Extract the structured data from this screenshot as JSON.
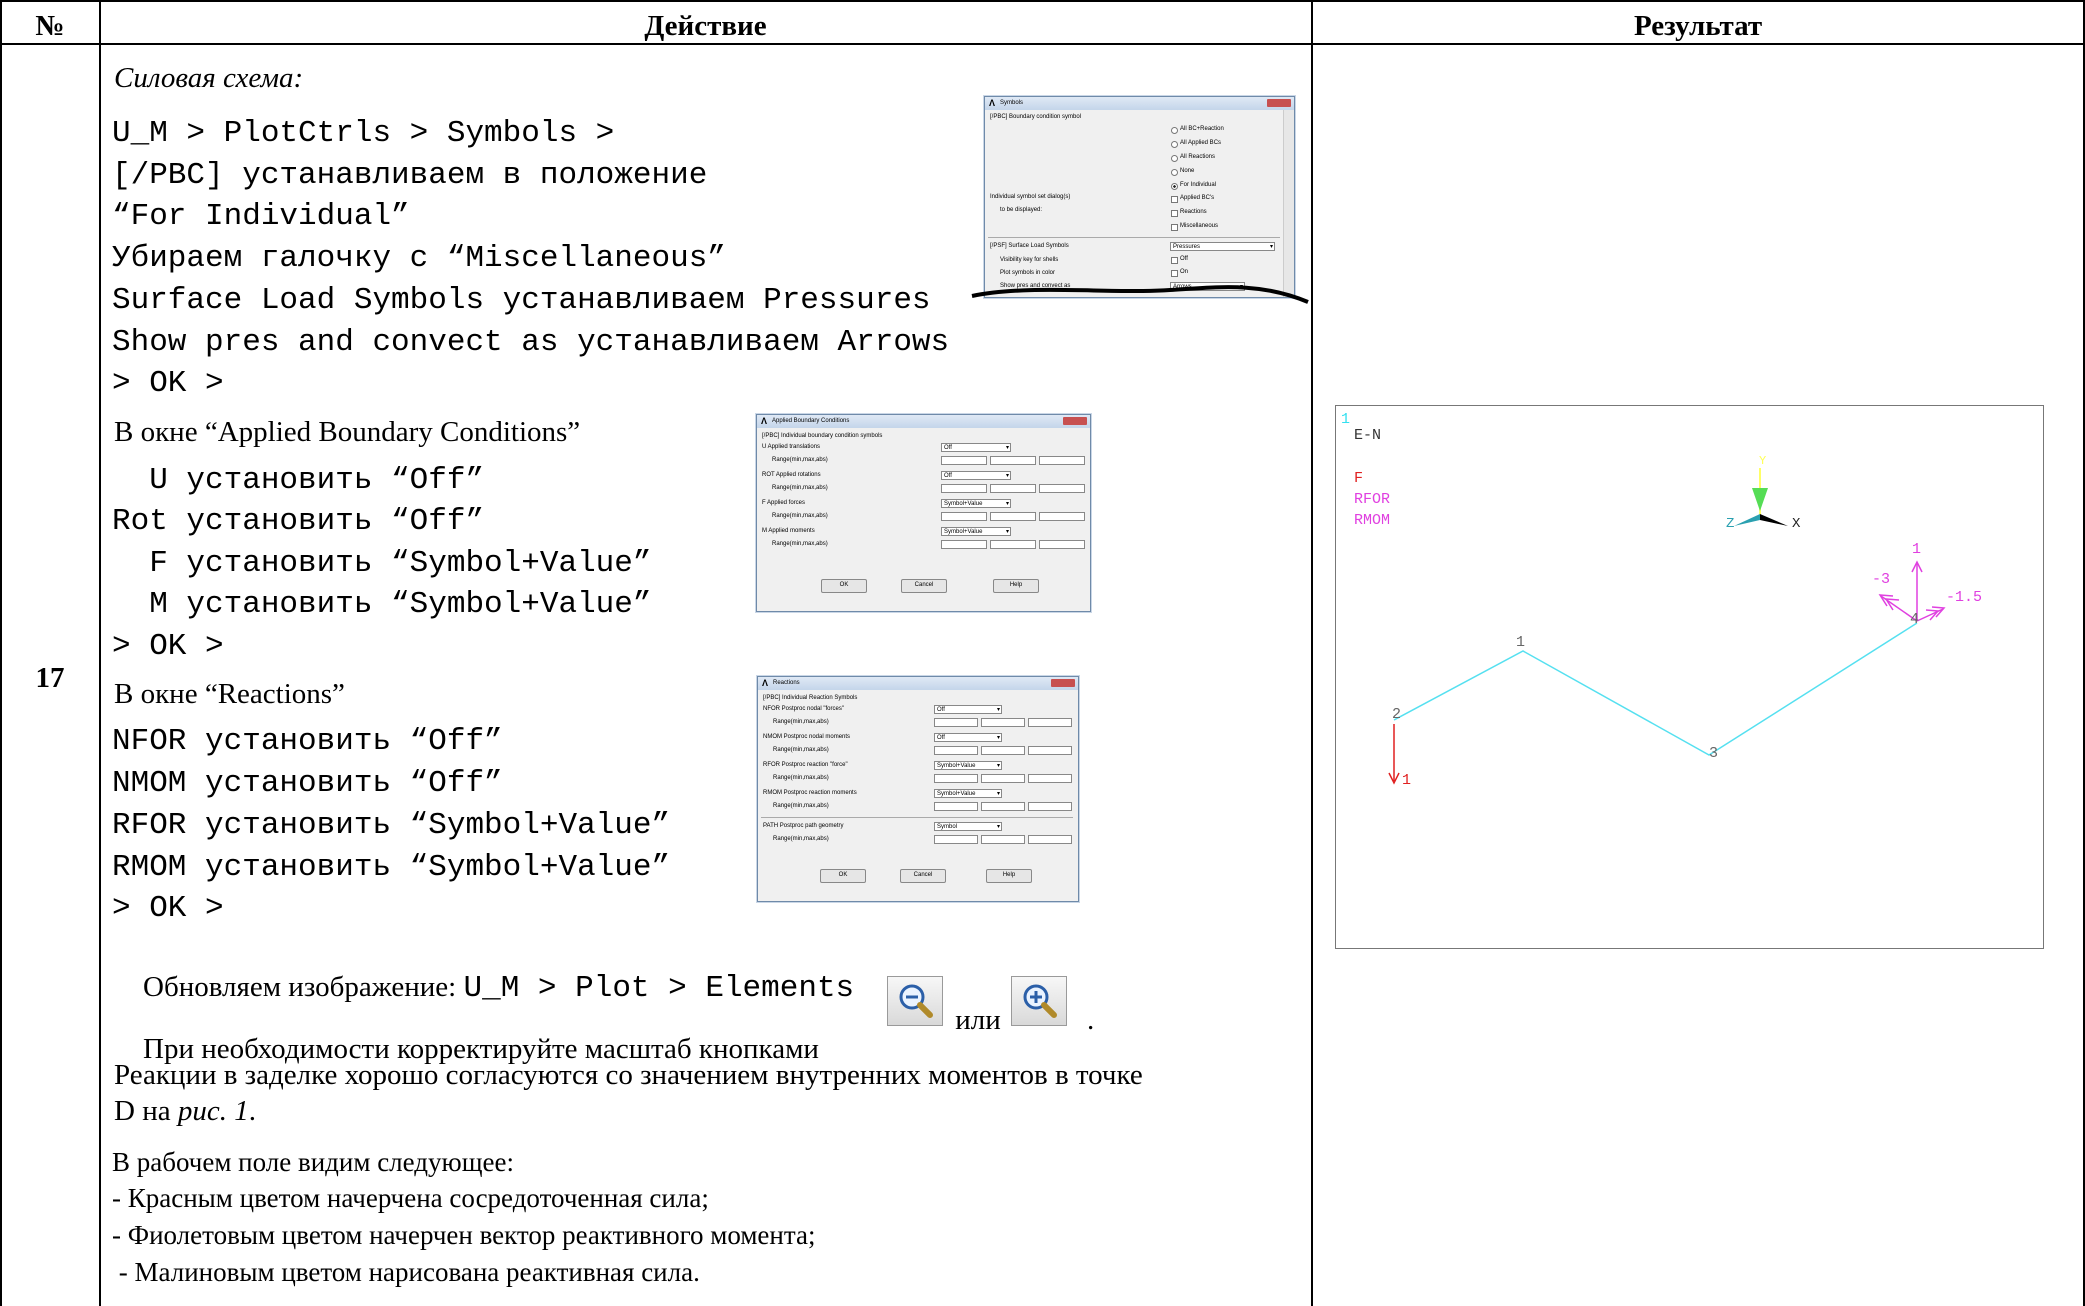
{
  "table": {
    "headers": {
      "no": "№",
      "action": "Действие",
      "result": "Результат"
    },
    "row_number": "17"
  },
  "action": {
    "heading": "Силовая схема:",
    "symbols_lines": [
      "U_M > PlotCtrls > Symbols >",
      "[/PBC] устанавливаем в положение",
      "“For Individual”",
      "Убираем галочку с “Miscellaneous”",
      "Surface Load Symbols устанавливаем Pressures",
      "Show pres and convect as устанавливаем Arrows",
      "> OK >"
    ],
    "abc_title": "В окне “Applied Boundary Conditions”",
    "abc_lines": [
      "  U установить “Off”",
      "Rot установить “Off”",
      "  F установить “Symbol+Value”",
      "  M установить “Symbol+Value”",
      "> OK >"
    ],
    "reactions_title": "В окне “Reactions”",
    "reactions_lines": [
      "NFOR установить “Off”",
      "NMOM установить “Off”",
      "RFOR установить “Symbol+Value”",
      "RMOM установить “Symbol+Value”",
      "> OK >"
    ],
    "refresh_prefix": "Обновляем изображение: ",
    "refresh_path": "U_M > Plot > Elements",
    "zoom_prefix": "При необходимости корректируйте масштаб кнопками ",
    "zoom_or": " или ",
    "zoom_suffix": ".",
    "note_line1": "Реакции в заделке хорошо согласуются со значением внутренних моментов в точке",
    "note_line2_prefix": "D на ",
    "note_line2_ref": "рис. 1",
    "note_line2_suffix": ".",
    "legend_intro": "В рабочем поле видим следующее:",
    "legend_items": [
      "- Красным цветом начерчена сосредоточенная сила;",
      "- Фиолетовым цветом начерчен вектор реактивного момента;",
      " - Малиновым цветом нарисована реактивная сила."
    ]
  },
  "dialogs": {
    "symbols": {
      "title": "Symbols",
      "pbc_label": "[/PBC] Boundary condition symbol",
      "radio_options": [
        "All BC+Reaction",
        "All Applied BCs",
        "All Reactions",
        "None",
        "For Individual"
      ],
      "individual_label": "Individual symbol set dialog(s)",
      "individual_label2": "to be displayed:",
      "check_options": [
        "Applied BC's",
        "Reactions",
        "Miscellaneous"
      ],
      "psf_label": "[/PSF] Surface Load Symbols",
      "psf_value": "Pressures",
      "vis_label": "Visibility key for shells",
      "vis_value": "Off",
      "color_label": "Plot symbols in color",
      "color_value": "On",
      "show_label": "Show pres and convect as",
      "show_value": "Arrows"
    },
    "abc": {
      "title": "Applied Boundary Conditions",
      "header": "[/PBC] Individual boundary condition symbols",
      "rows": [
        {
          "label": "U    Applied translations",
          "value": "Off"
        },
        {
          "label": "ROT   Applied rotations",
          "value": "Off"
        },
        {
          "label": "F     Applied forces",
          "value": "Symbol+Value"
        },
        {
          "label": "M     Applied moments",
          "value": "Symbol+Value"
        }
      ],
      "range_label": "Range(min,max,abs)",
      "ok": "OK",
      "cancel": "Cancel",
      "help": "Help"
    },
    "reactions": {
      "title": "Reactions",
      "header": "[/PBC] Individual Reaction Symbols",
      "rows": [
        {
          "label": "NFOR  Postproc nodal \"forces\"",
          "value": "Off"
        },
        {
          "label": "NMOM  Postproc nodal moments",
          "value": "Off"
        },
        {
          "label": "RFOR  Postproc reaction \"force\"",
          "value": "Symbol+Value"
        },
        {
          "label": "RMOM  Postproc reaction moments",
          "value": "Symbol+Value"
        },
        {
          "label": "PATH  Postproc path geometry",
          "value": "Symbol"
        }
      ],
      "range_label": "Range(min,max,abs)",
      "ok": "OK",
      "cancel": "Cancel",
      "help": "Help"
    }
  },
  "result": {
    "window_no": "1",
    "plot_type": "E-N",
    "legend": [
      "F",
      "RFOR",
      "RMOM"
    ],
    "axis_x": "X",
    "axis_y": "Y",
    "axis_z": "Z",
    "nodes": [
      "1",
      "2",
      "3",
      "4"
    ],
    "force_label": "1",
    "reaction_force_label": "1",
    "moment_labels": [
      "-3",
      "-1.5"
    ],
    "colors": {
      "structure": "#55e0f0",
      "force": "#e02020",
      "reaction": "#e040e0",
      "window_no": "#33e0f0",
      "legend_f": "#e02020",
      "legend_rfor": "#e040e0",
      "legend_rmom": "#e040e0"
    }
  },
  "icons": {
    "zoom_out": "zoom-out-icon",
    "zoom_in": "zoom-in-icon"
  }
}
